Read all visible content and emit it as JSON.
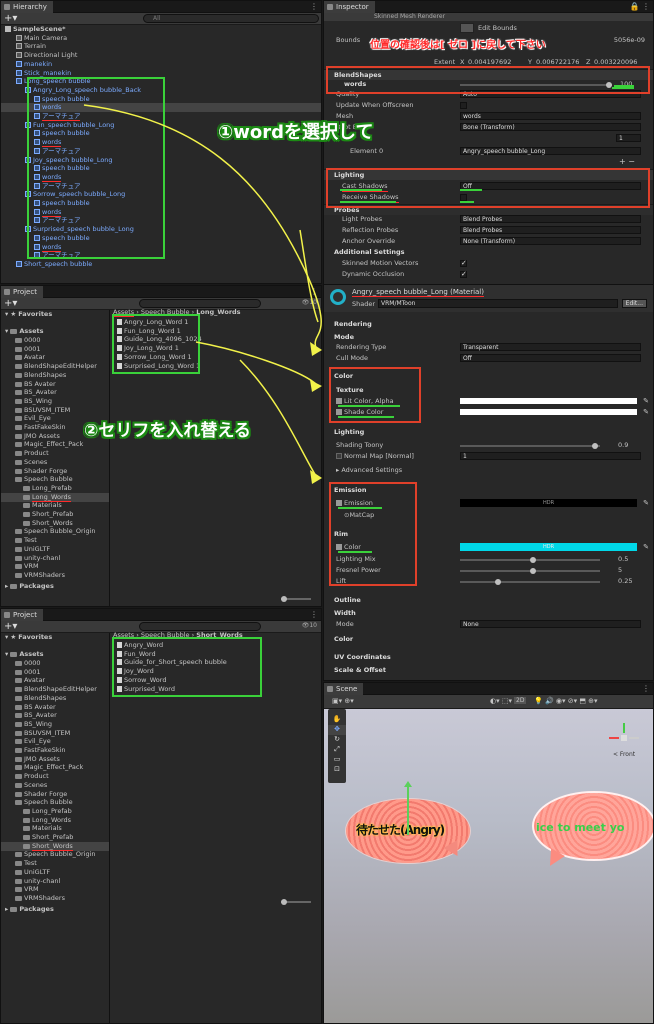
{
  "hierarchy": {
    "tab": "Hierarchy",
    "search_placeholder": "All",
    "scene": "SampleScene*",
    "items": [
      {
        "label": "Main Camera",
        "indent": 1
      },
      {
        "label": "Terrain",
        "indent": 1
      },
      {
        "label": "Directional Light",
        "indent": 1
      },
      {
        "label": "manekin",
        "indent": 1,
        "blue": true
      },
      {
        "label": "Stick_manekin",
        "indent": 1,
        "blue": true
      },
      {
        "label": "Long_speech bubble",
        "indent": 1,
        "blue": true
      },
      {
        "label": "Angry_Long_speech bubble_Back",
        "indent": 2,
        "blue": true
      },
      {
        "label": "speech bubble",
        "indent": 3,
        "blue": true
      },
      {
        "label": "words",
        "indent": 3,
        "blue": true,
        "selected": true
      },
      {
        "label": "アーマチュア",
        "indent": 3,
        "blue": true,
        "red": true
      },
      {
        "label": "Fun_speech bubble_Long",
        "indent": 2,
        "blue": true
      },
      {
        "label": "speech bubble",
        "indent": 3,
        "blue": true
      },
      {
        "label": "words",
        "indent": 3,
        "blue": true,
        "red": true
      },
      {
        "label": "アーマチュア",
        "indent": 3,
        "blue": true
      },
      {
        "label": "Joy_speech bubble_Long",
        "indent": 2,
        "blue": true
      },
      {
        "label": "speech bubble",
        "indent": 3,
        "blue": true
      },
      {
        "label": "words",
        "indent": 3,
        "blue": true,
        "red": true
      },
      {
        "label": "アーマチュア",
        "indent": 3,
        "blue": true
      },
      {
        "label": "Sorrow_speech bubble_Long",
        "indent": 2,
        "blue": true
      },
      {
        "label": "speech bubble",
        "indent": 3,
        "blue": true
      },
      {
        "label": "words",
        "indent": 3,
        "blue": true,
        "red": true
      },
      {
        "label": "アーマチュア",
        "indent": 3,
        "blue": true
      },
      {
        "label": "Surprised_speech bubble_Long",
        "indent": 2,
        "blue": true
      },
      {
        "label": "speech bubble",
        "indent": 3,
        "blue": true
      },
      {
        "label": "words",
        "indent": 3,
        "blue": true,
        "red": true
      },
      {
        "label": "アーマチュア",
        "indent": 3,
        "blue": true
      },
      {
        "label": "Short_speech bubble",
        "indent": 1,
        "blue": true
      }
    ]
  },
  "project1": {
    "tab": "Project",
    "count": "10",
    "favorites": "Favorites",
    "assets": "Assets",
    "breadcrumb": [
      "Assets",
      "Speech Bubble",
      "Long_Words"
    ],
    "tree": [
      {
        "label": "0000",
        "indent": 1
      },
      {
        "label": "0001",
        "indent": 1
      },
      {
        "label": "Avatar",
        "indent": 1
      },
      {
        "label": "BlendShapeEditHelper",
        "indent": 1
      },
      {
        "label": "BlendShapes",
        "indent": 1
      },
      {
        "label": "BS Avater",
        "indent": 1
      },
      {
        "label": "BS_Avater",
        "indent": 1
      },
      {
        "label": "BS_Wing",
        "indent": 1
      },
      {
        "label": "BSUVSM_ITEM",
        "indent": 1
      },
      {
        "label": "Evil_Eye",
        "indent": 1
      },
      {
        "label": "FastFakeSkin",
        "indent": 1
      },
      {
        "label": "JMO Assets",
        "indent": 1
      },
      {
        "label": "Magic_Effect_Pack",
        "indent": 1
      },
      {
        "label": "Product",
        "indent": 1
      },
      {
        "label": "Scenes",
        "indent": 1
      },
      {
        "label": "Shader Forge",
        "indent": 1
      },
      {
        "label": "Speech Bubble",
        "indent": 1
      },
      {
        "label": "Long_Prefab",
        "indent": 2
      },
      {
        "label": "Long_Words",
        "indent": 2,
        "selected": true
      },
      {
        "label": "Materials",
        "indent": 2
      },
      {
        "label": "Short_Prefab",
        "indent": 2
      },
      {
        "label": "Short_Words",
        "indent": 2
      },
      {
        "label": "Speech Bubble_Origin",
        "indent": 1
      },
      {
        "label": "Test",
        "indent": 1
      },
      {
        "label": "UniGLTF",
        "indent": 1
      },
      {
        "label": "unity-chanl",
        "indent": 1
      },
      {
        "label": "VRM",
        "indent": 1
      },
      {
        "label": "VRMShaders",
        "indent": 1
      }
    ],
    "packages": "Packages",
    "files": [
      "Angry_Long_Word 1",
      "Fun_Long_Word 1",
      "Guide_Long_4096_1024",
      "Joy_Long_Word 1",
      "Sorrow_Long_Word 1",
      "Surprised_Long_Word 1"
    ]
  },
  "project2": {
    "tab": "Project",
    "count": "10",
    "favorites": "Favorites",
    "assets": "Assets",
    "breadcrumb": [
      "Assets",
      "Speech Bubble",
      "Short_Words"
    ],
    "tree": [
      {
        "label": "0000",
        "indent": 1
      },
      {
        "label": "0001",
        "indent": 1
      },
      {
        "label": "Avatar",
        "indent": 1
      },
      {
        "label": "BlendShapeEditHelper",
        "indent": 1
      },
      {
        "label": "BlendShapes",
        "indent": 1
      },
      {
        "label": "BS Avater",
        "indent": 1
      },
      {
        "label": "BS_Avater",
        "indent": 1
      },
      {
        "label": "BS_Wing",
        "indent": 1
      },
      {
        "label": "BSUVSM_ITEM",
        "indent": 1
      },
      {
        "label": "Evil_Eye",
        "indent": 1
      },
      {
        "label": "FastFakeSkin",
        "indent": 1
      },
      {
        "label": "JMO Assets",
        "indent": 1
      },
      {
        "label": "Magic_Effect_Pack",
        "indent": 1
      },
      {
        "label": "Product",
        "indent": 1
      },
      {
        "label": "Scenes",
        "indent": 1
      },
      {
        "label": "Shader Forge",
        "indent": 1
      },
      {
        "label": "Speech Bubble",
        "indent": 1
      },
      {
        "label": "Long_Prefab",
        "indent": 2
      },
      {
        "label": "Long_Words",
        "indent": 2
      },
      {
        "label": "Materials",
        "indent": 2
      },
      {
        "label": "Short_Prefab",
        "indent": 2
      },
      {
        "label": "Short_Words",
        "indent": 2,
        "selected": true
      },
      {
        "label": "Speech Bubble_Origin",
        "indent": 1
      },
      {
        "label": "Test",
        "indent": 1
      },
      {
        "label": "UniGLTF",
        "indent": 1
      },
      {
        "label": "unity-chanl",
        "indent": 1
      },
      {
        "label": "VRM",
        "indent": 1
      },
      {
        "label": "VRMShaders",
        "indent": 1
      }
    ],
    "packages": "Packages",
    "files": [
      "Angry_Word",
      "Fun_Word",
      "Guide_for_Short_speech bubble",
      "Joy_Word",
      "Sorrow_Word",
      "Surprised_Word"
    ]
  },
  "inspector": {
    "tab": "Inspector",
    "component": "Skinned Mesh Renderer",
    "edit_bounds": "Edit Bounds",
    "bounds_label": "Bounds",
    "bounds_value": "5056e-09",
    "extent_label": "Extent",
    "extent": {
      "x": "0.004197692",
      "y": "0.006722176",
      "z": "0.003220096"
    },
    "blendshapes": "BlendShapes",
    "words_label": "words",
    "words_value": "100",
    "quality_label": "Quality",
    "quality_value": "Auto",
    "update_offscreen": "Update When Offscreen",
    "mesh_label": "Mesh",
    "mesh_value": "words",
    "root_bone_label": "Root Bone",
    "root_bone_value": "Bone (Transform)",
    "materials_count": "1",
    "element_label": "Element 0",
    "element_value": "Angry_speech bubble_Long",
    "lighting": "Lighting",
    "cast_shadows_label": "Cast Shadows",
    "cast_shadows_value": "Off",
    "receive_shadows_label": "Receive Shadows",
    "probes": "Probes",
    "light_probes_label": "Light Probes",
    "light_probes_value": "Blend Probes",
    "reflection_probes_label": "Reflection Probes",
    "reflection_probes_value": "Blend Probes",
    "anchor_override_label": "Anchor Override",
    "anchor_override_value": "None (Transform)",
    "additional": "Additional Settings",
    "skinned_motion_label": "Skinned Motion Vectors",
    "dynamic_occlusion_label": "Dynamic Occlusion",
    "material_name": "Angry_speech bubble_Long (Material)",
    "shader_label": "Shader",
    "shader_value": "VRM/MToon",
    "edit_label": "Edit...",
    "rendering": "Rendering",
    "mode_label": "Mode",
    "rendering_type_label": "Rendering Type",
    "rendering_type_value": "Transparent",
    "cull_mode_label": "Cull Mode",
    "cull_mode_value": "Off",
    "color": "Color",
    "texture": "Texture",
    "lit_color_label": "Lit Color, Alpha",
    "shade_color_label": "Shade Color",
    "lighting2": "Lighting",
    "shading_toony_label": "Shading Toony",
    "shading_toony_value": "0.9",
    "normal_map_label": "Normal Map [Normal]",
    "normal_map_value": "1",
    "advanced_label": "Advanced Settings",
    "emission": "Emission",
    "emission_label": "Emission",
    "hdr": "HDR",
    "matcap_label": "MatCap",
    "rim": "Rim",
    "rim_color_label": "Color",
    "lighting_mix_label": "Lighting Mix",
    "lighting_mix_value": "0.5",
    "fresnel_label": "Fresnel Power",
    "fresnel_value": "5",
    "lift_label": "Lift",
    "lift_value": "0.25",
    "outline": "Outline",
    "width": "Width",
    "outline_mode_label": "Mode",
    "outline_mode_value": "None",
    "color2": "Color",
    "uv": "UV Coordinates",
    "scale_offset": "Scale & Offset"
  },
  "scene": {
    "tab": "Scene",
    "mode_2d": "2D",
    "persp": "< Front",
    "bubble1_text": "待たせた(Angry)",
    "bubble2_text": "ice to meet yo"
  },
  "annotations": {
    "a1": "①wordを選択して",
    "a2": "②セリフを入れ替える",
    "a3": "位置の確認後は[ ゼロ ]に戻して下さい"
  },
  "colors": {
    "green": "#3ad13a",
    "red": "#e0402a",
    "cyan": "#00d8e8",
    "bubble": "#ff8a8a"
  }
}
